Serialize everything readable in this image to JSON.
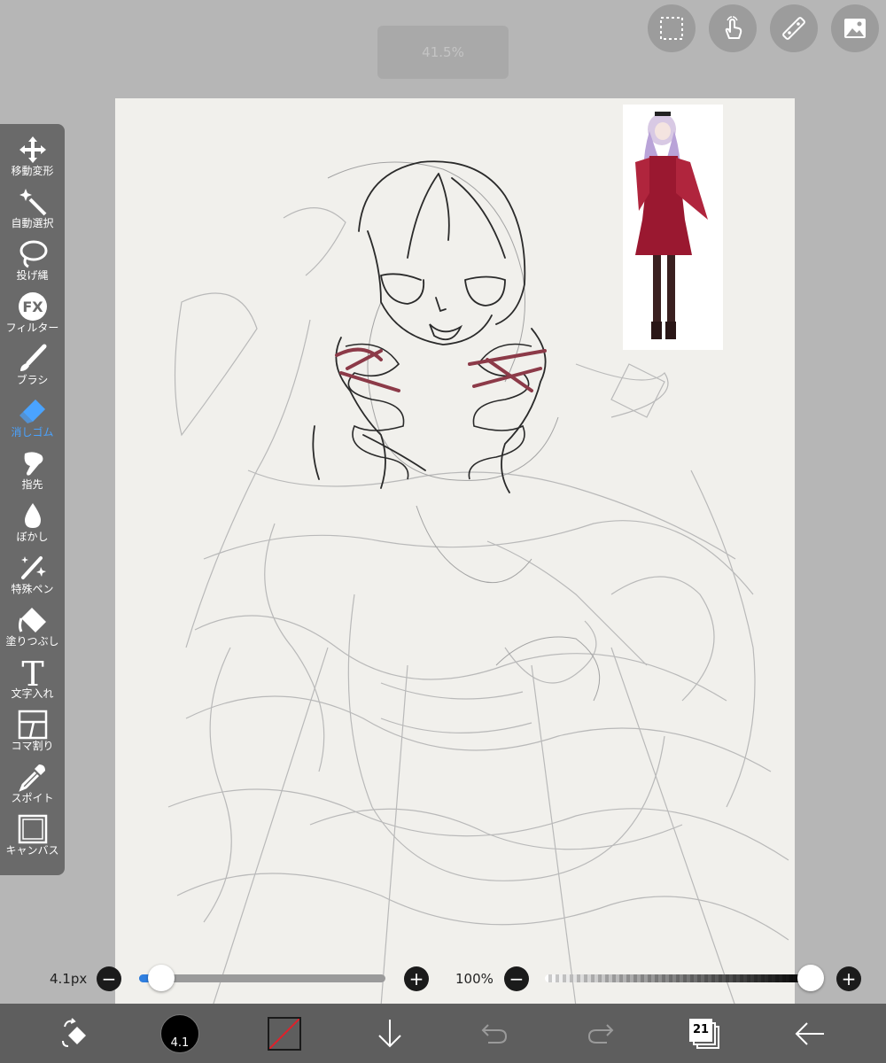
{
  "zoom_label": "41.5%",
  "top_buttons": [
    {
      "name": "selection-icon"
    },
    {
      "name": "gesture-hand-icon"
    },
    {
      "name": "ruler-icon"
    },
    {
      "name": "material-image-icon"
    }
  ],
  "tools": [
    {
      "label": "移動変形",
      "icon": "move-transform-icon"
    },
    {
      "label": "自動選択",
      "icon": "magic-wand-icon"
    },
    {
      "label": "投げ縄",
      "icon": "lasso-icon"
    },
    {
      "label": "フィルター",
      "icon": "filter-fx-icon"
    },
    {
      "label": "ブラシ",
      "icon": "brush-icon"
    },
    {
      "label": "消しゴム",
      "icon": "eraser-icon",
      "active": true
    },
    {
      "label": "指先",
      "icon": "smudge-finger-icon"
    },
    {
      "label": "ぼかし",
      "icon": "blur-drop-icon"
    },
    {
      "label": "特殊ペン",
      "icon": "special-pen-icon"
    },
    {
      "label": "塗りつぶし",
      "icon": "fill-bucket-icon"
    },
    {
      "label": "文字入れ",
      "icon": "text-icon"
    },
    {
      "label": "コマ割り",
      "icon": "panel-division-icon"
    },
    {
      "label": "スポイト",
      "icon": "eyedropper-icon"
    },
    {
      "label": "キャンバス",
      "icon": "canvas-icon"
    }
  ],
  "fx_glyph": "FX",
  "text_glyph": "T",
  "brush_size": {
    "label": "4.1px",
    "fraction": 0.09
  },
  "opacity": {
    "label": "100%",
    "fraction": 1.0
  },
  "minus_glyph": "−",
  "plus_glyph": "+",
  "bottom_bar": {
    "brush_preview_label": "4.1",
    "layer_count": "21"
  },
  "colors": {
    "accent": "#4aa3ff",
    "slider_fill": "#2f7fe0",
    "ribbon": "#8c3a48"
  }
}
